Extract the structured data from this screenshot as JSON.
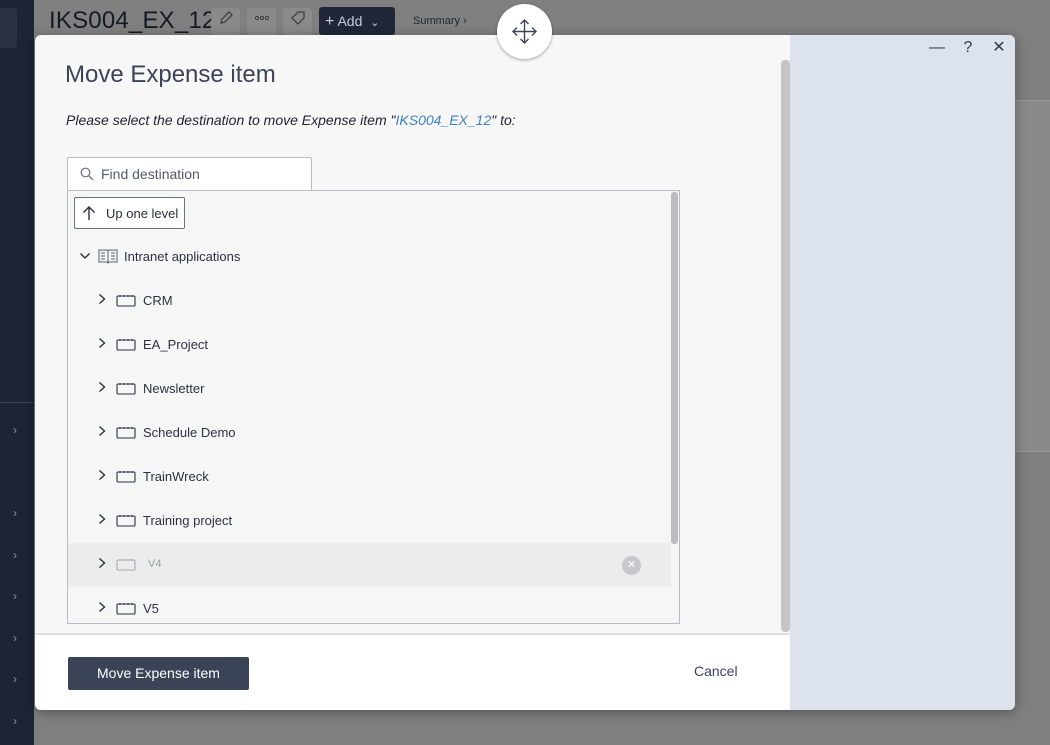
{
  "background": {
    "page_title": "IKS004_EX_12",
    "add_label": "Add",
    "summary_label": "Summary ›"
  },
  "dialog": {
    "title": "Move Expense item",
    "description_prefix": "Please select the destination to move Expense item \"",
    "item_name": "IKS004_EX_12",
    "description_suffix": "\" to:",
    "search_placeholder": "Find destination",
    "up_label": "Up one level",
    "root": {
      "label": "Intranet applications",
      "icon": "book-icon"
    },
    "children": [
      {
        "label": "CRM",
        "icon": "folder-icon",
        "disabled": false
      },
      {
        "label": "EA_Project",
        "icon": "folder-icon",
        "disabled": false
      },
      {
        "label": "Newsletter",
        "icon": "folder-icon",
        "disabled": false
      },
      {
        "label": "Schedule Demo",
        "icon": "folder-icon",
        "disabled": false
      },
      {
        "label": "TrainWreck",
        "icon": "folder-icon",
        "disabled": false
      },
      {
        "label": "Training project",
        "icon": "folder-icon",
        "disabled": false
      },
      {
        "label": "V4",
        "icon": "folder-icon",
        "disabled": true
      },
      {
        "label": "V5",
        "icon": "folder-icon",
        "disabled": false
      }
    ],
    "move_label": "Move Expense item",
    "cancel_label": "Cancel",
    "window_controls": {
      "minimize": "—",
      "help": "?",
      "close": "✕"
    }
  },
  "colors": {
    "primary": "#3b4357",
    "link": "#3e82c1",
    "side_panel": "#dce3ec"
  }
}
